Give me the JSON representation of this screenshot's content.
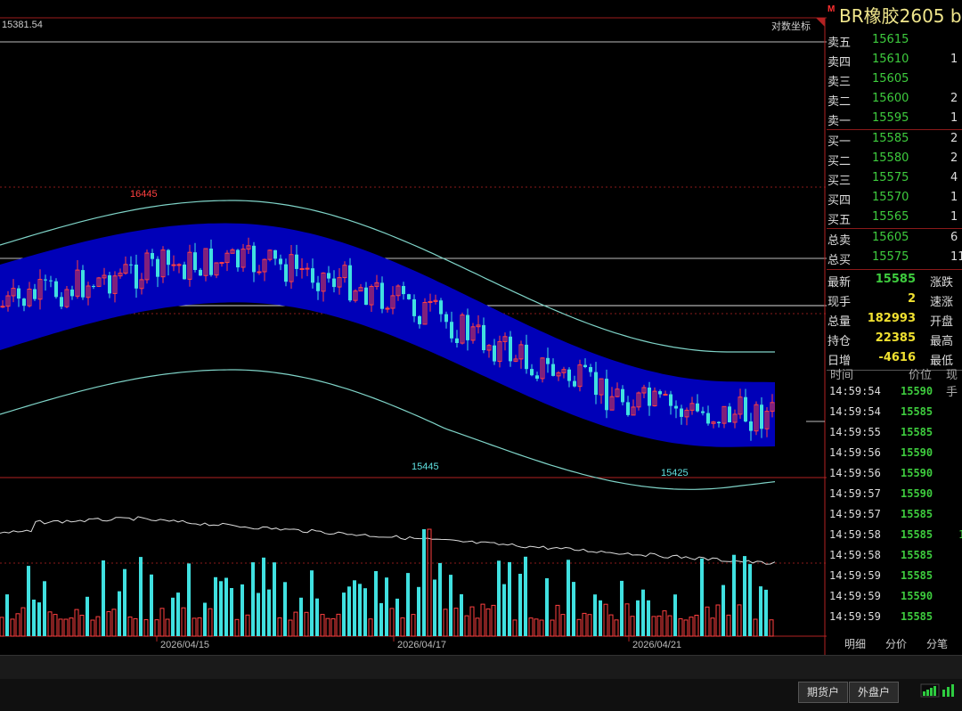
{
  "chart_data": {
    "type": "candlestick",
    "x_labels": [
      "2026/04/15",
      "2026/04/17",
      "2026/04/21"
    ],
    "top_value": "15381.54",
    "axis_mode": "对数坐标",
    "high_label": "16445",
    "low_labels": [
      "15445",
      "15425"
    ],
    "colors": {
      "up": "#ff4040",
      "down": "#40e0e0",
      "band": "#0000b8",
      "band_line": "#7fd4c8",
      "volume_line": "#dddddd"
    }
  },
  "panel": {
    "mark": "M",
    "title": "BR橡胶2605  b",
    "sell_rows": [
      {
        "label": "卖五",
        "price": "15615",
        "vol": ""
      },
      {
        "label": "卖四",
        "price": "15610",
        "vol": "1"
      },
      {
        "label": "卖三",
        "price": "15605",
        "vol": ""
      },
      {
        "label": "卖二",
        "price": "15600",
        "vol": "2"
      },
      {
        "label": "卖一",
        "price": "15595",
        "vol": "1"
      }
    ],
    "buy_rows": [
      {
        "label": "买一",
        "price": "15585",
        "vol": "2"
      },
      {
        "label": "买二",
        "price": "15580",
        "vol": "2"
      },
      {
        "label": "买三",
        "price": "15575",
        "vol": "4"
      },
      {
        "label": "买四",
        "price": "15570",
        "vol": "1"
      },
      {
        "label": "买五",
        "price": "15565",
        "vol": "1"
      }
    ],
    "total_rows": [
      {
        "label": "总卖",
        "price": "15605",
        "vol": "6"
      },
      {
        "label": "总买",
        "price": "15575",
        "vol": "11"
      }
    ],
    "stats": [
      {
        "label": "最新",
        "value": "15585",
        "color": "#3ecc3e",
        "label2": "涨跌"
      },
      {
        "label": "现手",
        "value": "2",
        "color": "#f0e030",
        "label2": "速涨"
      },
      {
        "label": "总量",
        "value": "182993",
        "color": "#f0e030",
        "label2": "开盘"
      },
      {
        "label": "持仓",
        "value": "22385",
        "color": "#f0e030",
        "label2": "最高"
      },
      {
        "label": "日增",
        "value": "-4616",
        "color": "#f0e030",
        "label2": "最低"
      }
    ],
    "tick_header": {
      "time": "时间",
      "price": "价位",
      "vol": "现手"
    },
    "ticks": [
      {
        "time": "14:59:54",
        "price": "15590",
        "vol": ""
      },
      {
        "time": "14:59:54",
        "price": "15585",
        "vol": ""
      },
      {
        "time": "14:59:55",
        "price": "15585",
        "vol": ""
      },
      {
        "time": "14:59:56",
        "price": "15590",
        "vol": ""
      },
      {
        "time": "14:59:56",
        "price": "15590",
        "vol": ""
      },
      {
        "time": "14:59:57",
        "price": "15590",
        "vol": ""
      },
      {
        "time": "14:59:57",
        "price": "15585",
        "vol": ""
      },
      {
        "time": "14:59:58",
        "price": "15585",
        "vol": "1"
      },
      {
        "time": "14:59:58",
        "price": "15585",
        "vol": ""
      },
      {
        "time": "14:59:59",
        "price": "15585",
        "vol": ""
      },
      {
        "time": "14:59:59",
        "price": "15590",
        "vol": ""
      },
      {
        "time": "14:59:59",
        "price": "15585",
        "vol": ""
      }
    ],
    "tabs": [
      "明细",
      "分价",
      "分笔"
    ]
  },
  "bottom": {
    "buttons": [
      "期货户",
      "外盘户"
    ]
  }
}
